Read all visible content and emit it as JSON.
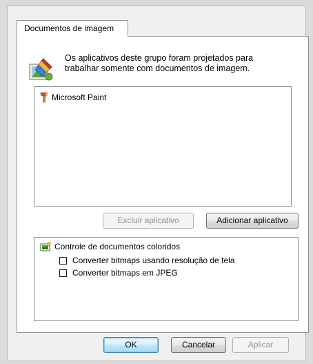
{
  "tab": {
    "label": "Documentos de imagem"
  },
  "description": {
    "line1": "Os aplicativos deste grupo foram projetados para",
    "line2": "trabalhar somente com documentos de imagem."
  },
  "app_list": {
    "items": [
      {
        "label": "Microsoft Paint",
        "icon": "paint-brush-icon"
      }
    ]
  },
  "app_buttons": {
    "remove_label": "Excluir aplicativo",
    "add_label": "Adicionar aplicativo"
  },
  "color_options": {
    "header": "Controle de documentos coloridos",
    "options": [
      {
        "label": "Converter bitmaps usando resolução de tela",
        "checked": false
      },
      {
        "label": "Converter bitmaps em JPEG",
        "checked": false
      }
    ]
  },
  "footer": {
    "ok_label": "OK",
    "cancel_label": "Cancelar",
    "apply_label": "Aplicar"
  },
  "colors": {
    "default_button_border": "#3c7fb1",
    "disabled_text": "#8f8f8f",
    "list_border": "#828790"
  }
}
